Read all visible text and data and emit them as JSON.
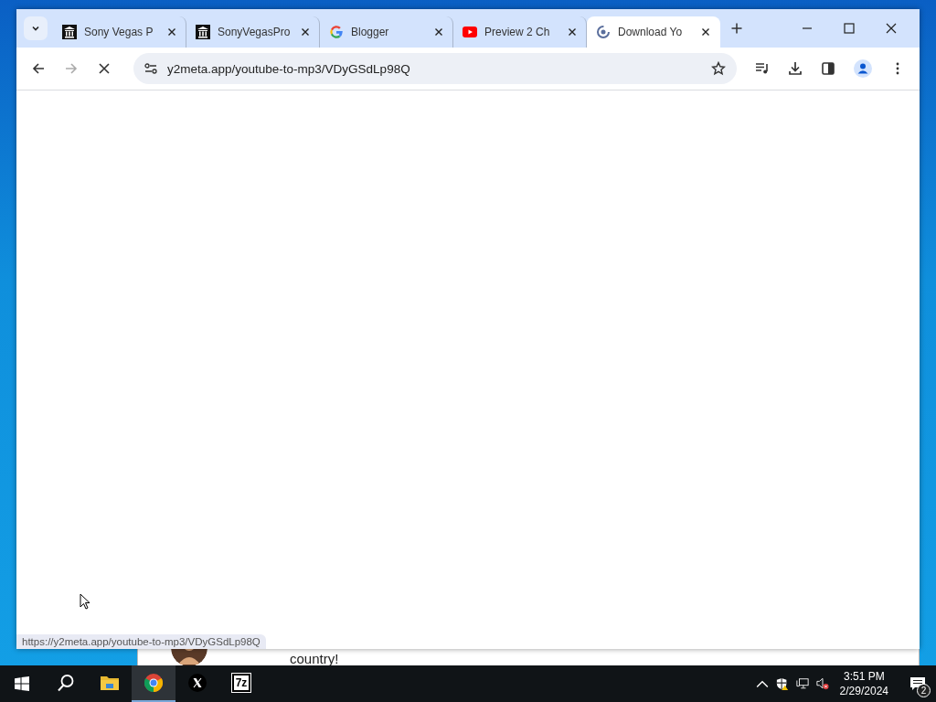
{
  "browser": {
    "tabs": [
      {
        "title": "Sony Vegas P",
        "kind": "museum",
        "selected": false
      },
      {
        "title": "SonyVegasPro",
        "kind": "museum",
        "selected": false
      },
      {
        "title": "Blogger",
        "kind": "google",
        "selected": false
      },
      {
        "title": "Preview 2 Ch",
        "kind": "video",
        "selected": false
      },
      {
        "title": "Download Yo",
        "kind": "loading",
        "selected": true
      }
    ],
    "address": "y2meta.app/youtube-to-mp3/VDyGSdLp98Q",
    "forward_disabled": true,
    "loading": true,
    "status_url": "https://y2meta.app/youtube-to-mp3/VDyGSdLp98Q"
  },
  "background_window": {
    "text": "country!"
  },
  "taskbar": {
    "apps": [
      {
        "kind": "search",
        "selected": false
      },
      {
        "kind": "explorer",
        "selected": false
      },
      {
        "kind": "chrome",
        "selected": true
      },
      {
        "kind": "x",
        "selected": false
      },
      {
        "kind": "sevenzip",
        "label": "7z",
        "selected": false
      }
    ],
    "time": "3:51 PM",
    "date": "2/29/2024",
    "notifications": "2"
  }
}
